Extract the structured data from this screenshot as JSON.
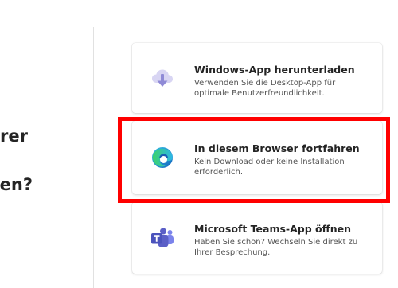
{
  "heading": {
    "line1": "rer",
    "line2": "nen?"
  },
  "options": [
    {
      "title": "Windows-App herunterladen",
      "description": "Verwenden Sie die Desktop-App für optimale Benutzerfreundlichkeit.",
      "icon": "cloud-download-icon"
    },
    {
      "title": "In diesem Browser fortfahren",
      "description": "Kein Download oder keine Installation erforderlich.",
      "icon": "edge-browser-icon"
    },
    {
      "title": "Microsoft Teams-App öffnen",
      "description": "Haben Sie schon? Wechseln Sie direkt zu Ihrer Besprechung.",
      "icon": "teams-icon"
    }
  ],
  "colors": {
    "highlight": "#ff0000",
    "teams_purple": "#5b5fc7",
    "download_icon": "#8f8ad6"
  }
}
